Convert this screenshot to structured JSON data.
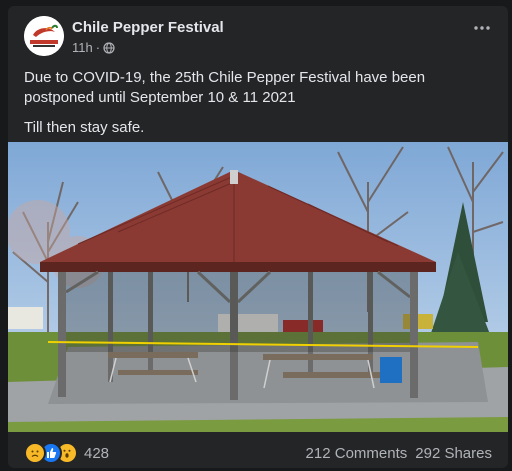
{
  "post": {
    "page_name": "Chile Pepper Festival",
    "time": "11h",
    "privacy_icon": "globe-icon",
    "more_icon": "more-icon",
    "avatar_text": "CHILE PEPPER FESTIVAL",
    "paragraphs": [
      "Due to COVID-19, the 25th Chile Pepper Festival have been postponed until September 10 & 11 2021",
      "Till then stay safe."
    ],
    "photo_icon": "pavilion-photo"
  },
  "footer": {
    "reaction_icons": [
      "sad-icon",
      "like-icon",
      "wow-icon"
    ],
    "reaction_count": "428",
    "comments": "212 Comments",
    "shares": "292 Shares"
  },
  "colors": {
    "background": "#18191a",
    "card": "#242526",
    "text_primary": "#e4e6eb",
    "text_secondary": "#b0b3b8",
    "like_blue": "#1877f2",
    "reaction_yellow": "#f7b928"
  }
}
